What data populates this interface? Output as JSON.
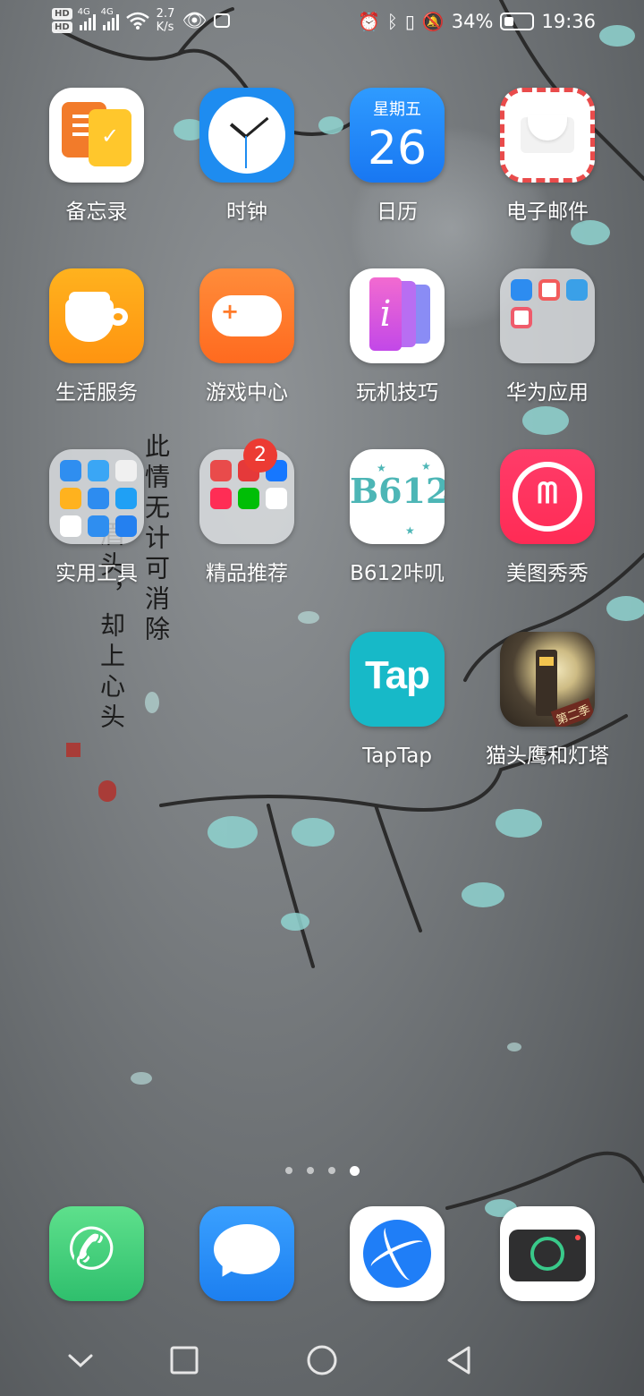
{
  "status_bar": {
    "hd1": "HD",
    "hd2": "HD",
    "net1": "4G",
    "net2": "4G",
    "speed_value": "2.7",
    "speed_unit": "K/s",
    "battery": "34%",
    "time": "19:36"
  },
  "wallpaper": {
    "poem_line1": "此情无计可消除",
    "poem_line2": "眉头，却上心头"
  },
  "apps": [
    {
      "label": "备忘录",
      "icon": "memo-icon"
    },
    {
      "label": "时钟",
      "icon": "clock-icon"
    },
    {
      "label": "日历",
      "icon": "calendar-icon",
      "weekday": "星期五",
      "day": "26"
    },
    {
      "label": "电子邮件",
      "icon": "mail-icon"
    },
    {
      "label": "生活服务",
      "icon": "coffee-cup-icon"
    },
    {
      "label": "游戏中心",
      "icon": "gamepad-icon"
    },
    {
      "label": "玩机技巧",
      "icon": "tips-icon"
    },
    {
      "label": "华为应用",
      "icon": "folder-icon"
    },
    {
      "label": "实用工具",
      "icon": "folder-icon"
    },
    {
      "label": "精品推荐",
      "icon": "folder-icon",
      "badge": "2"
    },
    {
      "label": "B612咔叽",
      "icon": "b612-icon",
      "logo": "B612"
    },
    {
      "label": "美图秀秀",
      "icon": "meitu-icon"
    },
    {
      "label": "TapTap",
      "icon": "taptap-icon",
      "logo": "Tap"
    },
    {
      "label": "猫头鹰和灯塔",
      "icon": "lighthouse-icon",
      "tag": "第二季"
    }
  ],
  "page_indicator": {
    "pages": 4,
    "current": 4
  },
  "dock": [
    {
      "name": "phone",
      "icon": "phone-icon"
    },
    {
      "name": "messages",
      "icon": "message-bubble-icon"
    },
    {
      "name": "browser",
      "icon": "globe-icon"
    },
    {
      "name": "camera",
      "icon": "camera-icon"
    }
  ],
  "navigation": [
    "collapse-down-icon",
    "recents-square-icon",
    "home-circle-icon",
    "back-triangle-icon"
  ],
  "colors": {
    "badge": "#ec3b33",
    "taptap": "#17b9c8",
    "meitu": "#ff2b55",
    "calendar": "#1877f2"
  }
}
